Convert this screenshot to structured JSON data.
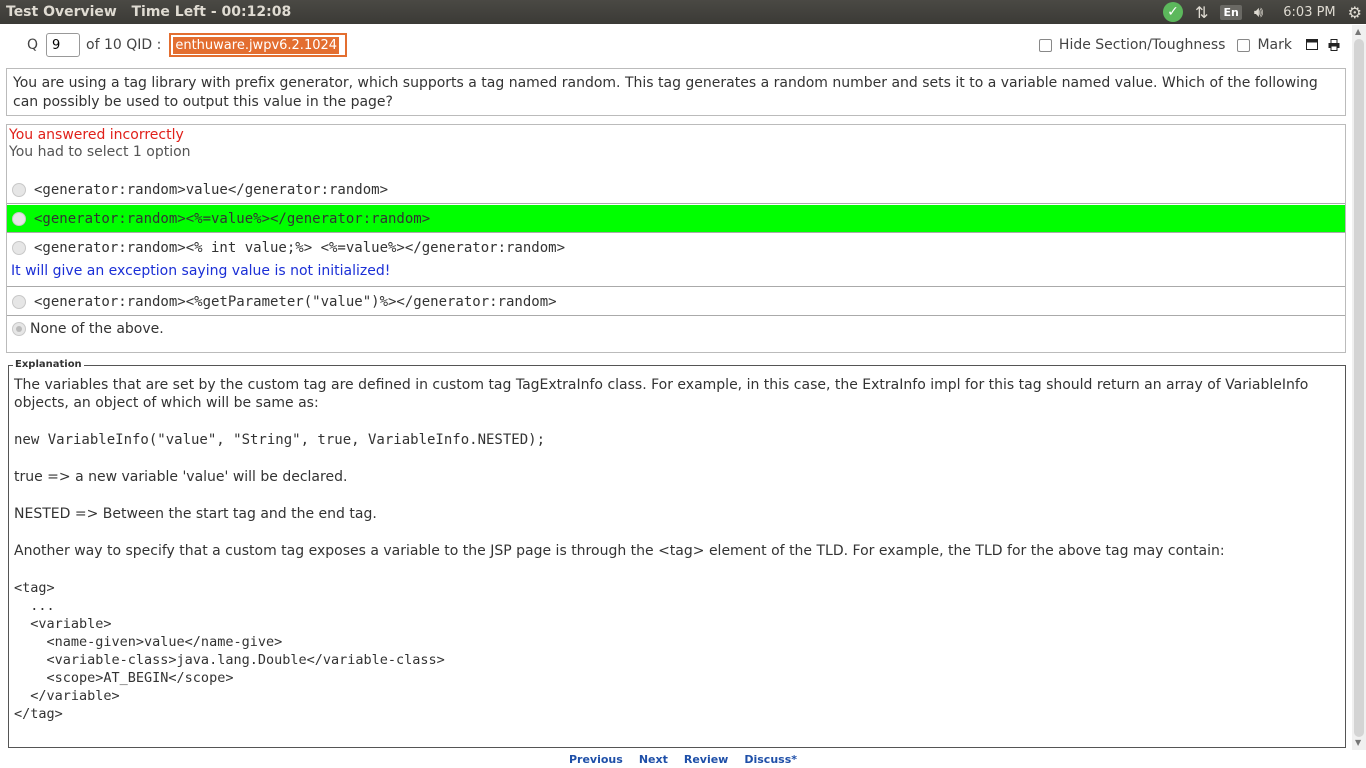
{
  "topbar": {
    "title": "Test Overview   Time Left - 00:12:08",
    "lang": "En",
    "time": "6:03 PM",
    "icons": [
      "check-icon",
      "network-arrows-icon",
      "volume-icon",
      "power-gear-icon"
    ]
  },
  "header": {
    "q_label": "Q",
    "q_value": "9",
    "of_label": "of 10  QID :",
    "qid": "enthuware.jwpv6.2.1024",
    "hide_label": "Hide Section/Toughness",
    "mark_label": "Mark"
  },
  "question": "You are using a tag library with prefix generator, which supports a tag named random. This tag generates a random number and sets it to a variable named value. Which of the following can possibly be used to output this value in the page?",
  "result": {
    "status": "You answered incorrectly",
    "instruction": "You had to select 1 option"
  },
  "options": [
    {
      "text": "<generator:random>value</generator:random>"
    },
    {
      "text": "<generator:random><%=value%></generator:random>",
      "correct": true
    },
    {
      "text": "<generator:random><% int value;%> <%=value%></generator:random>",
      "comment": "It will give an exception saying value is not initialized!"
    },
    {
      "text": "<generator:random><%getParameter(\"value\")%></generator:random>"
    },
    {
      "text": "None of the above.",
      "selected": true
    }
  ],
  "explanation": {
    "legend": "Explanation",
    "p1": "The variables that are set by the custom tag are defined in custom tag TagExtraInfo class. For example, in this case, the ExtraInfo impl for this tag should return an array of VariableInfo objects, an object of which will be same as:",
    "code1": "new VariableInfo(\"value\", \"String\", true, VariableInfo.NESTED);",
    "p2": "true => a new variable 'value' will be declared.",
    "p3": "NESTED => Between the start tag and the end tag.",
    "p4": "Another way to specify that a custom tag exposes a variable to the JSP page is through the <tag> element of the TLD. For example, the TLD for the above tag may contain:",
    "code2": "<tag>\n  ...\n  <variable>\n    <name-given>value</name-give>\n    <variable-class>java.lang.Double</variable-class>\n    <scope>AT_BEGIN</scope>\n  </variable>\n</tag>"
  },
  "nav": {
    "previous": "Previous",
    "next": "Next",
    "review": "Review",
    "discuss": "Discuss*"
  },
  "colors": {
    "correct": "#00ff00",
    "wrong_text": "#e0201a",
    "comment_text": "#1b2fd6",
    "qid_highlight": "#e36e30"
  }
}
